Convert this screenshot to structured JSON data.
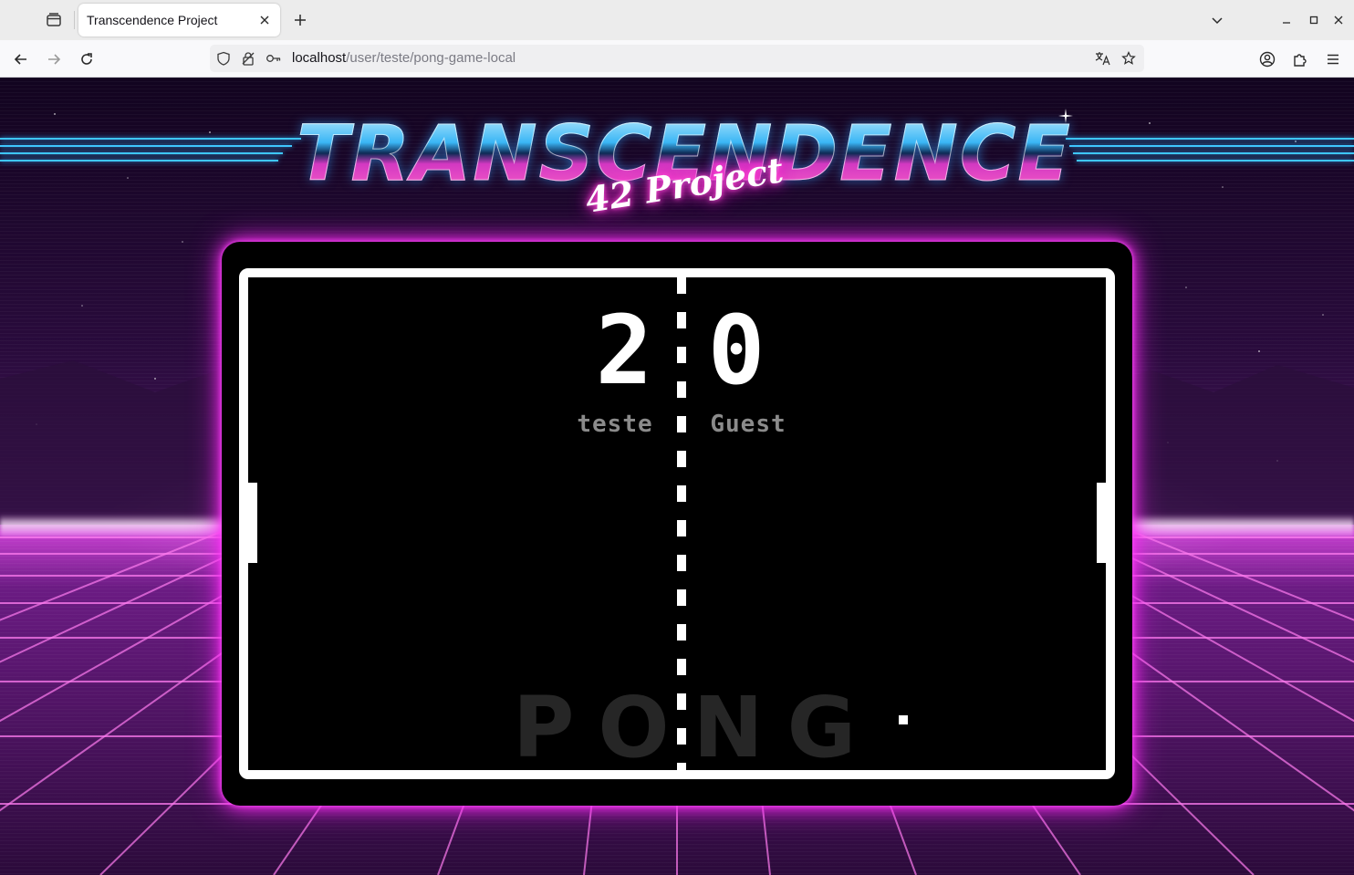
{
  "browser": {
    "tab": {
      "title": "Transcendence Project",
      "close_icon": "close-icon"
    },
    "controls": {
      "tab_list_icon": "tab-list-icon",
      "new_tab_icon": "plus-icon",
      "tab_overflow_icon": "chevron-down-icon",
      "minimize_icon": "minimize-icon",
      "maximize_icon": "maximize-icon",
      "close_window_icon": "close-icon"
    },
    "nav": {
      "back_icon": "back-arrow-icon",
      "forward_icon": "forward-arrow-icon",
      "reload_icon": "reload-icon",
      "account_icon": "account-icon",
      "extensions_icon": "puzzle-icon",
      "menu_icon": "hamburger-menu-icon"
    },
    "url": {
      "host": "localhost",
      "path": "/user/teste/pong-game-local",
      "icons": [
        "shield-icon",
        "lock-icon",
        "key-icon",
        "translate-icon",
        "star-icon"
      ]
    }
  },
  "page": {
    "logo": {
      "title": "TRANSCENDENCE",
      "subtitle": "42 Project"
    },
    "colors": {
      "accent_pink": "#ff2cf4",
      "accent_blue": "#3fc6ff",
      "court": "#000000",
      "lines": "#ffffff"
    },
    "game": {
      "left_player": {
        "name": "teste",
        "score": "2"
      },
      "right_player": {
        "name": "Guest",
        "score": "0"
      },
      "watermark": "PONG"
    }
  }
}
